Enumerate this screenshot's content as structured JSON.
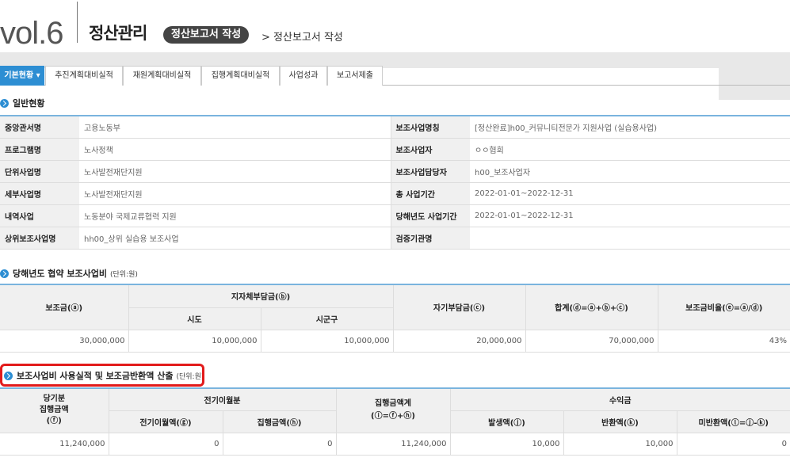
{
  "header": {
    "vol": "vol.6",
    "title": "정산관리",
    "pill": "정산보고서 작성",
    "breadcrumb": "> 정산보고서 작성"
  },
  "tabs": [
    {
      "label": "기본현황 ▾",
      "active": true
    },
    {
      "label": "추진계획대비실적"
    },
    {
      "label": "재원계획대비실적"
    },
    {
      "label": "집행계획대비실적"
    },
    {
      "label": "사업성과"
    },
    {
      "label": "보고서제출"
    }
  ],
  "section1": {
    "title": "일반현황"
  },
  "info_rows": [
    {
      "l1": "중앙관서명",
      "v1": "고용노동부",
      "l2": "보조사업명칭",
      "v2": "[정산완료]h00_커뮤니티전문가 지원사업 (실습용사업)"
    },
    {
      "l1": "프로그램명",
      "v1": "노사정책",
      "l2": "보조사업자",
      "v2": "ㅇㅇ협회"
    },
    {
      "l1": "단위사업명",
      "v1": "노사발전재단지원",
      "l2": "보조사업담당자",
      "v2": "h00_보조사업자"
    },
    {
      "l1": "세부사업명",
      "v1": "노사발전재단지원",
      "l2": "총 사업기간",
      "v2": "2022-01-01~2022-12-31"
    },
    {
      "l1": "내역사업",
      "v1": "노동분야 국제교류협력 지원",
      "l2": "당해년도 사업기간",
      "v2": "2022-01-01~2022-12-31"
    },
    {
      "l1": "상위보조사업명",
      "v1": "hh00_상위 실습용 보조사업",
      "l2": "검증기관명",
      "v2": ""
    }
  ],
  "section2": {
    "title": "당해년도 협약 보조사업비",
    "unit": "(단위:원)"
  },
  "agreement": {
    "h_subsidy": "보조금(ⓐ)",
    "h_local": "지자체부담금(ⓑ)",
    "h_sido": "시도",
    "h_sigungu": "시군구",
    "h_self": "자기부담금(ⓒ)",
    "h_total": "합계(ⓓ=ⓐ+ⓑ+ⓒ)",
    "h_ratio": "보조금비율(ⓔ=ⓐ/ⓓ)",
    "v_subsidy": "30,000,000",
    "v_sido": "10,000,000",
    "v_sigungu": "10,000,000",
    "v_self": "20,000,000",
    "v_total": "70,000,000",
    "v_ratio": "43%"
  },
  "section3": {
    "title": "보조사업비 사용실적 및 보조금반환액 산출",
    "unit": "(단위:원)"
  },
  "usage": {
    "h_current_1": "당기분",
    "h_current_2": "집행금액",
    "h_current_3": "(ⓕ)",
    "h_carry": "전기이월분",
    "h_carry_amt": "전기이월액(ⓖ)",
    "h_carry_exec": "집행금액(ⓗ)",
    "h_exec_total_1": "집행금액계",
    "h_exec_total_2": "(ⓘ=ⓕ+ⓗ)",
    "h_income": "수익금",
    "h_occur": "발생액(ⓙ)",
    "h_return": "반환액(ⓚ)",
    "h_unreturned": "미반환액(ⓛ=ⓙ-ⓚ)",
    "v_current": "11,240,000",
    "v_carry_amt": "0",
    "v_carry_exec": "0",
    "v_exec_total": "11,240,000",
    "v_occur": "10,000",
    "v_return": "10,000",
    "v_unreturned": "0"
  },
  "colors": {
    "accent": "#2d8ed3",
    "highlight": "#e21b1b"
  },
  "icons": [
    "chevron-right-icon"
  ]
}
